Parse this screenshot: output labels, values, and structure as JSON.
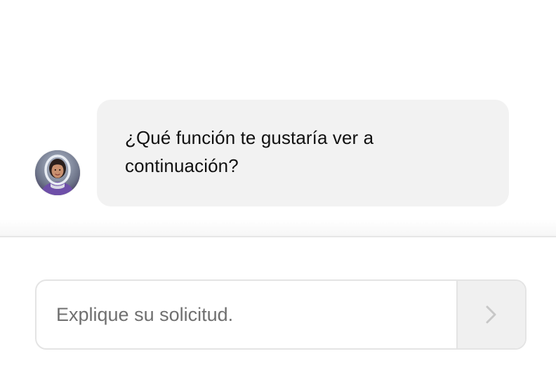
{
  "conversation": {
    "assistant_message": "¿Qué función te gustaría ver a continuación?",
    "avatar_icon": "astronaut-avatar"
  },
  "composer": {
    "placeholder": "Explique su solicitud.",
    "value": "",
    "send_icon": "chevron-right-icon"
  },
  "colors": {
    "bubble_background": "#f2f2f2",
    "send_button_background": "#f0f0f0",
    "border": "#e4e4e4",
    "placeholder_text": "#6f6f6f"
  }
}
